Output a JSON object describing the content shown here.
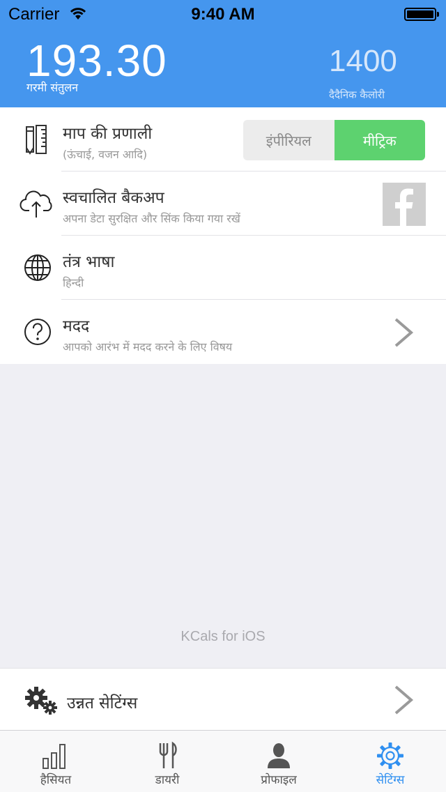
{
  "status_bar": {
    "carrier": "Carrier",
    "time": "9:40 AM"
  },
  "header": {
    "balance_value": "193.30",
    "balance_label": "गरमी संतुलन",
    "daily_value": "1400",
    "daily_label": "दैदैनिक कैलोरी"
  },
  "settings": {
    "rows": [
      {
        "icon": "ruler-pencil-icon",
        "title": "माप की प्रणाली",
        "subtitle": "(ऊंचाई, वजन आदि)"
      },
      {
        "icon": "cloud-upload-icon",
        "title": "स्वचालित बैकअप",
        "subtitle": "अपना डेटा सुरक्षित और सिंक किया गया रखें"
      },
      {
        "icon": "globe-icon",
        "title": "तंत्र भाषा",
        "subtitle": "हिन्दी"
      },
      {
        "icon": "help-icon",
        "title": "मदद",
        "subtitle": "आपको आरंभ में मदद करने के लिए विषय"
      }
    ],
    "unit_options": {
      "imperial": "इंपीरियल",
      "metric": "मीट्रिक",
      "selected": "metric"
    },
    "backup_service": "facebook-icon"
  },
  "footer_text": "KCals for iOS",
  "advanced": {
    "title": "उन्नत सेटिंग्स"
  },
  "tabs": [
    {
      "label": "हैसियत",
      "icon": "bar-chart-icon"
    },
    {
      "label": "डायरी",
      "icon": "fork-knife-icon"
    },
    {
      "label": "प्रोफाइल",
      "icon": "person-icon"
    },
    {
      "label": "सेटिंग्स",
      "icon": "gear-icon",
      "active": true
    }
  ],
  "colors": {
    "header": "#4596ee",
    "accent_green": "#5dd26f",
    "active_tab": "#2f8ff0"
  }
}
